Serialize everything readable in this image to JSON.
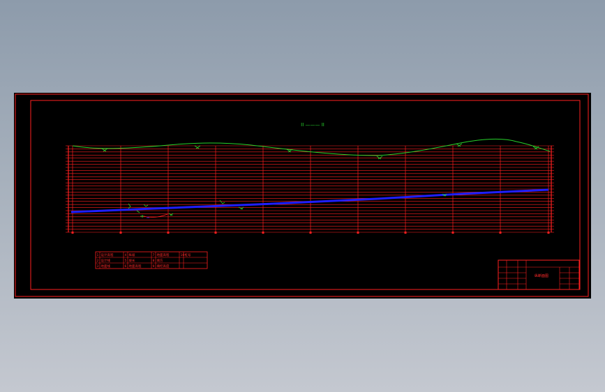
{
  "colors": {
    "frame": "#ff1f1f",
    "ground_line": "#27d22b",
    "design_line": "#1f1fff",
    "background": "#000000",
    "text": "#ff2a2a"
  },
  "section_label": "II ——— II",
  "title_block": {
    "drawing_name": "纵断面图"
  },
  "legend": {
    "rows": [
      [
        "1",
        "设计高程",
        "4",
        "纵坡",
        "7",
        "地面高程",
        "10",
        "桩号"
      ],
      [
        "2",
        "设计线",
        "5",
        "坡长",
        "8",
        "填方",
        "",
        ""
      ],
      [
        "3",
        "地面线",
        "6",
        "地面高程",
        "9",
        "填挖高度",
        "",
        ""
      ]
    ]
  }
}
